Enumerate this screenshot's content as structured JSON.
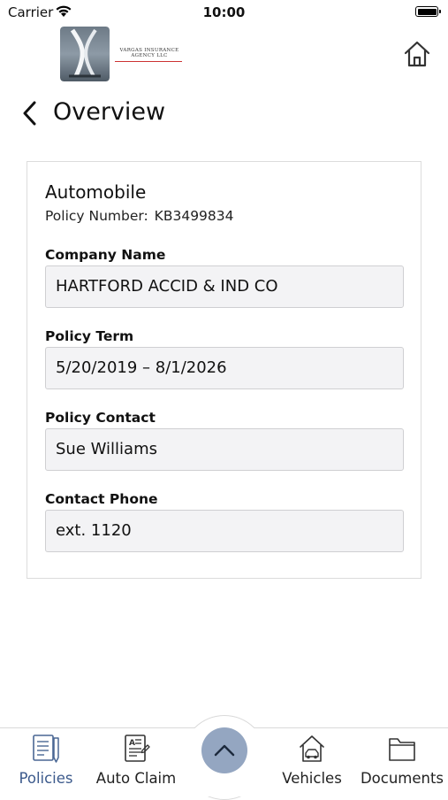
{
  "status_bar": {
    "carrier": "Carrier",
    "time": "10:00"
  },
  "header": {
    "logo_text_line1": "VARGAS INSURANCE",
    "logo_text_line2": "AGENCY LLC"
  },
  "nav": {
    "title": "Overview"
  },
  "policy": {
    "type": "Automobile",
    "number_label": "Policy Number:",
    "number": "KB3499834",
    "fields": [
      {
        "label": "Company Name",
        "value": "HARTFORD ACCID & IND CO"
      },
      {
        "label": "Policy Term",
        "value": "5/20/2019 – 8/1/2026"
      },
      {
        "label": "Policy Contact",
        "value": "Sue Williams"
      },
      {
        "label": "Contact Phone",
        "value": "ext. 1120"
      }
    ]
  },
  "tab_bar": {
    "tabs": [
      {
        "label": "Policies",
        "icon": "policies-icon",
        "active": true
      },
      {
        "label": "Auto Claim",
        "icon": "auto-claim-icon",
        "active": false
      },
      {
        "label": "Vehicles",
        "icon": "vehicles-icon",
        "active": false
      },
      {
        "label": "Documents",
        "icon": "documents-icon",
        "active": false
      }
    ],
    "center_button_icon": "chevron-up-icon"
  },
  "colors": {
    "accent": "#3c5a8c",
    "fab": "#94a6c1",
    "field_bg": "#f3f3f5"
  }
}
